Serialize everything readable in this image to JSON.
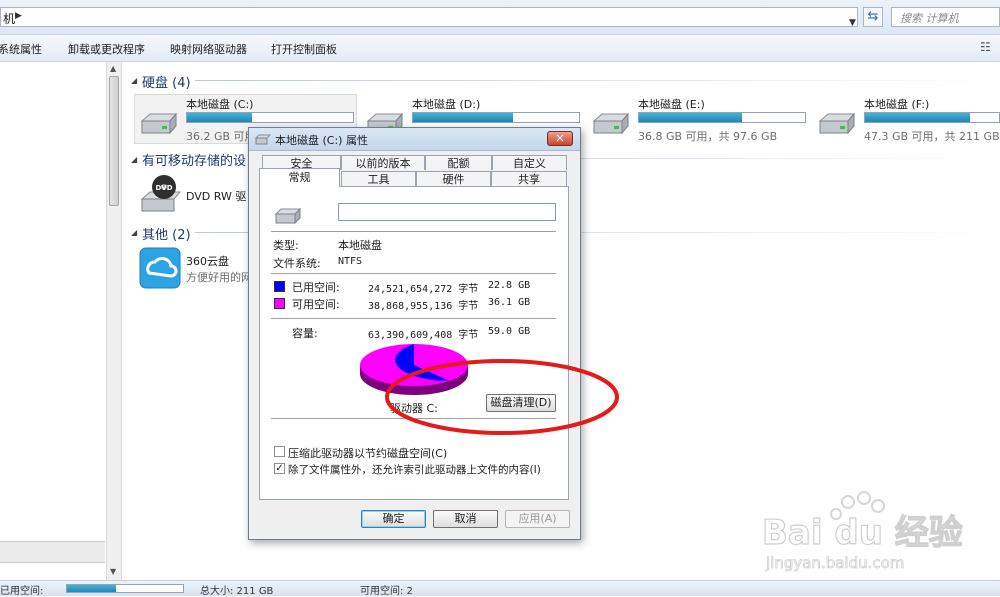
{
  "address_bar": {
    "path_fragment": "机",
    "search_placeholder": "搜索 计算机"
  },
  "toolbar": {
    "items": [
      "系统属性",
      "卸载或更改程序",
      "映射网络驱动器",
      "打开控制面板"
    ]
  },
  "groups": {
    "hard_disks": {
      "title": "硬盘 (4)"
    },
    "removable": {
      "title": "有可移动存储的设"
    },
    "other": {
      "title": "其他 (2)"
    }
  },
  "drives": [
    {
      "name": "本地磁盘 (C:)",
      "space": "36.2 GB 可用",
      "used_fraction": 0.39
    },
    {
      "name": "本地磁盘 (D:)",
      "space": "",
      "used_fraction": 0.6
    },
    {
      "name": "本地磁盘 (E:)",
      "space": "36.8 GB 可用，共 97.6 GB",
      "used_fraction": 0.62
    },
    {
      "name": "本地磁盘 (F:)",
      "space": "47.3 GB 可用，共 211 GB",
      "used_fraction": 0.78
    }
  ],
  "dvd": {
    "name": "DVD RW 驱",
    "badge": "DVD"
  },
  "cloud": {
    "name": "360云盘",
    "desc": "方便好用的网"
  },
  "status_bar": {
    "left_text": "已用空间:",
    "used_fraction": 0.42,
    "fragments": [
      "总大小: 211 GB",
      "可用空间: 2"
    ]
  },
  "dialog": {
    "title": "本地磁盘 (C:) 属性",
    "close": "✕",
    "tabs_row1": [
      "安全",
      "以前的版本",
      "配额",
      "自定义"
    ],
    "tabs_row2": [
      "常规",
      "工具",
      "硬件",
      "共享"
    ],
    "name_value": "",
    "type_label": "类型:",
    "type_value": "本地磁盘",
    "fs_label": "文件系统:",
    "fs_value": "NTFS",
    "used_label": "已用空间:",
    "used_bytes": "24,521,654,272 字节",
    "used_gb": "22.8 GB",
    "free_label": "可用空间:",
    "free_bytes": "38,868,955,136 字节",
    "free_gb": "36.1 GB",
    "capacity_label": "容量:",
    "capacity_bytes": "63,390,609,408 字节",
    "capacity_gb": "59.0 GB",
    "drive_label": "驱动器 C:",
    "cleanup_button": "磁盘清理(D)",
    "compress_label": "压缩此驱动器以节约磁盘空间(C)",
    "index_label": "除了文件属性外，还允许索引此驱动器上文件的内容(I)",
    "compress_checked": false,
    "index_checked": true,
    "ok": "确定",
    "cancel": "取消",
    "apply": "应用(A)",
    "used_fraction": 0.387,
    "used_color": "#0000ff",
    "free_color": "#ff00ff"
  },
  "annotation": {
    "color": "#e31b1b"
  },
  "watermark": {
    "brand": "Bai du 经验",
    "url": "jingyan.baidu.com"
  }
}
